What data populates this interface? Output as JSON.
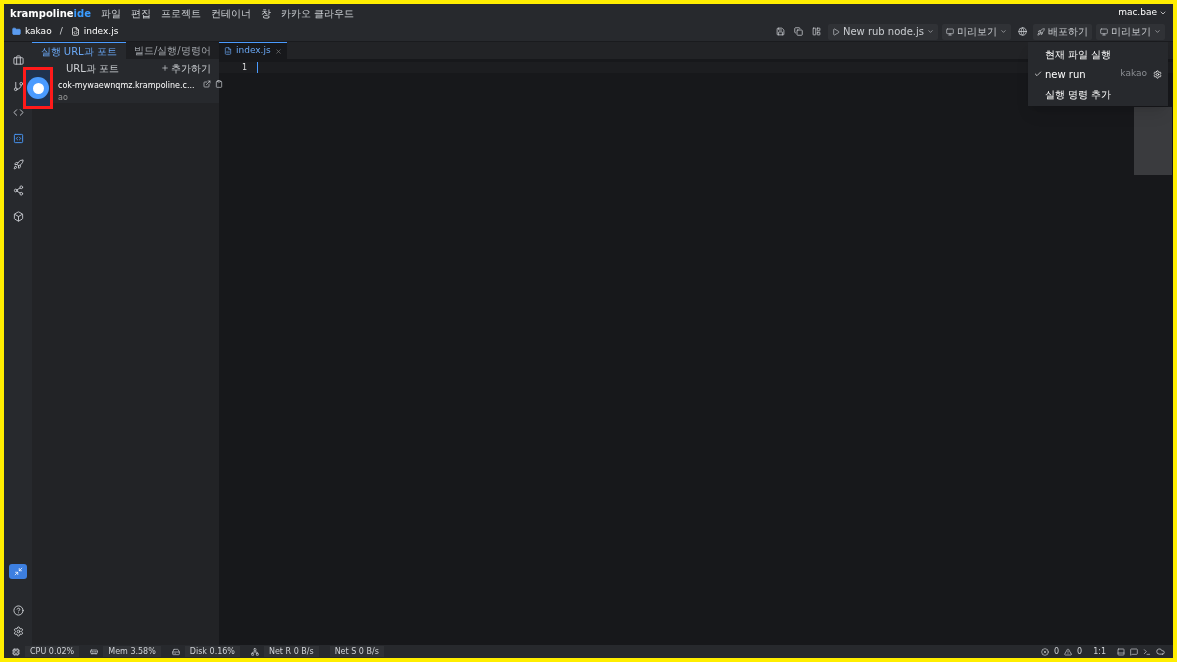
{
  "app": {
    "logo_main": "krampoline",
    "logo_accent": "ide"
  },
  "menu": [
    "파일",
    "편집",
    "프로젝트",
    "컨테이너",
    "창",
    "카카오 클라우드"
  ],
  "user": "mac.bae",
  "breadcrumb": [
    {
      "kind": "folder",
      "label": "kakao"
    },
    {
      "kind": "separator",
      "label": "/"
    },
    {
      "kind": "file",
      "label": "index.js"
    }
  ],
  "toolbar": [
    {
      "kind": "icon"
    },
    {
      "kind": "icon"
    },
    {
      "kind": "icon"
    },
    {
      "kind": "menu",
      "label": "New rub node.js"
    },
    {
      "kind": "menu",
      "label": "미리보기"
    },
    {
      "kind": "icon"
    },
    {
      "kind": "button",
      "label": "배포하기"
    },
    {
      "kind": "menu",
      "label": "미리보기"
    }
  ],
  "activity": [
    {
      "selected": false
    },
    {
      "selected": false
    },
    {
      "selected": false
    },
    {
      "selected": true
    },
    {
      "selected": false
    },
    {
      "selected": false
    },
    {
      "selected": false
    }
  ],
  "panel_tabs": [
    {
      "label": "실행 URL과 포트",
      "selected": true
    },
    {
      "label": "빌드/실행/명령어",
      "selected": false
    }
  ],
  "panel": {
    "heading": "URL과 포트",
    "add": "추가하기",
    "url": "cok-mywaewnqmz.krampoline.c...",
    "url_sub": "ao"
  },
  "editor_tabs": [
    {
      "label": "index.js",
      "selected": true
    }
  ],
  "editor": {
    "line_numbers": [
      "1"
    ]
  },
  "dropdown": [
    {
      "label": "현재 파일 실행",
      "checked": false
    },
    {
      "label": "new run",
      "checked": true,
      "tag": "kakao"
    },
    {
      "label": "실행 명령 추가",
      "checked": false
    }
  ],
  "status_left": [
    "CPU 0.02%",
    "Mem 3.58%",
    "Disk 0.16%",
    "Net R 0 B/s",
    "Net S 0 B/s"
  ],
  "status_right": {
    "errors": "0",
    "warnings": "0",
    "position": "1:1"
  }
}
